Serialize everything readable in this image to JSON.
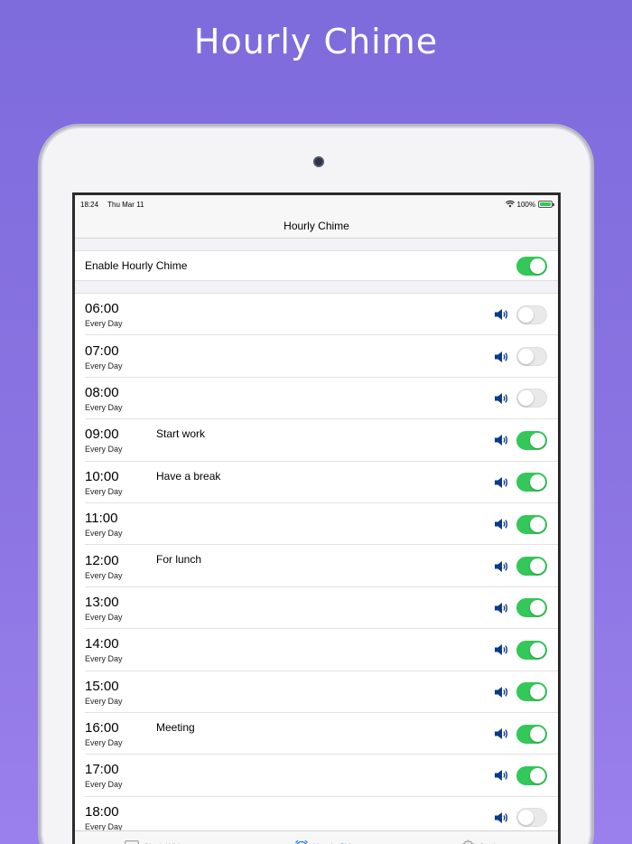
{
  "promo": {
    "title": "Hourly Chime"
  },
  "status_bar": {
    "time": "18:24",
    "date": "Thu Mar 11",
    "battery": "100%"
  },
  "nav": {
    "title": "Hourly Chime"
  },
  "enable": {
    "label": "Enable Hourly Chime",
    "on": true
  },
  "chimes": [
    {
      "time": "06:00",
      "repeat": "Every Day",
      "label": "",
      "on": false
    },
    {
      "time": "07:00",
      "repeat": "Every Day",
      "label": "",
      "on": false
    },
    {
      "time": "08:00",
      "repeat": "Every Day",
      "label": "",
      "on": false
    },
    {
      "time": "09:00",
      "repeat": "Every Day",
      "label": "Start work",
      "on": true
    },
    {
      "time": "10:00",
      "repeat": "Every Day",
      "label": "Have a break",
      "on": true
    },
    {
      "time": "11:00",
      "repeat": "Every Day",
      "label": "",
      "on": true
    },
    {
      "time": "12:00",
      "repeat": "Every Day",
      "label": "For lunch",
      "on": true
    },
    {
      "time": "13:00",
      "repeat": "Every Day",
      "label": "",
      "on": true
    },
    {
      "time": "14:00",
      "repeat": "Every Day",
      "label": "",
      "on": true
    },
    {
      "time": "15:00",
      "repeat": "Every Day",
      "label": "",
      "on": true
    },
    {
      "time": "16:00",
      "repeat": "Every Day",
      "label": "Meeting",
      "on": true
    },
    {
      "time": "17:00",
      "repeat": "Every Day",
      "label": "",
      "on": true
    },
    {
      "time": "18:00",
      "repeat": "Every Day",
      "label": "",
      "on": false
    }
  ],
  "tabs": [
    {
      "label": "Clock Widgets",
      "icon": "widgets-icon",
      "active": false
    },
    {
      "label": "Hourly Chime",
      "icon": "alarm-clock-icon",
      "active": true
    },
    {
      "label": "Settings",
      "icon": "gear-icon",
      "active": false
    }
  ],
  "colors": {
    "accent": "#1a7ff0",
    "toggle_on": "#34c759",
    "speaker": "#0a3a8c",
    "background": "#8a74e2"
  }
}
